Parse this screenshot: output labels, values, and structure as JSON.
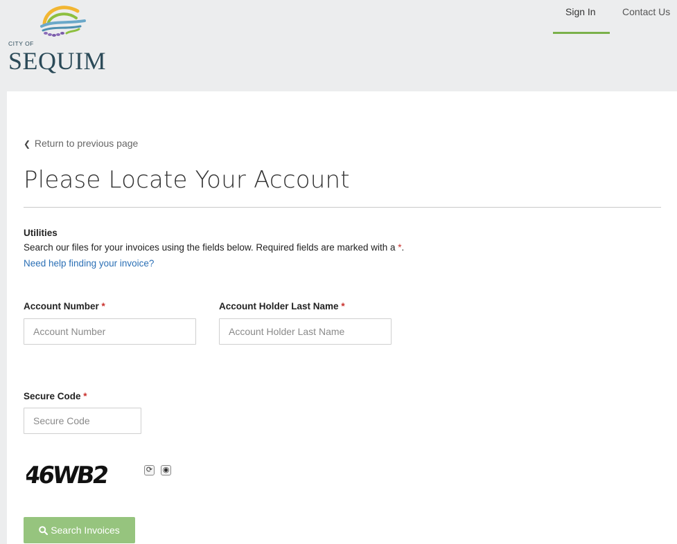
{
  "header": {
    "logo_small": "CITY OF",
    "logo_big": "SEQUIM",
    "nav": {
      "sign_in": "Sign In",
      "contact_us": "Contact Us"
    },
    "colors": {
      "background": "#ecedee",
      "active_underline": "#7ab04a"
    }
  },
  "main": {
    "back_link": "Return to previous page",
    "title": "Please Locate Your Account",
    "section_title": "Utilities",
    "intro_text": "Search our files for your invoices using the fields below.  Required fields are marked with a ",
    "intro_star": "*",
    "intro_end": ".",
    "help_link": "Need help finding your invoice?",
    "fields": {
      "account_number": {
        "label": "Account Number",
        "placeholder": "Account Number",
        "required_mark": "*"
      },
      "last_name": {
        "label": "Account Holder Last Name",
        "placeholder": "Account Holder Last Name",
        "required_mark": "*"
      },
      "secure_code": {
        "label": "Secure Code",
        "placeholder": "Secure Code",
        "required_mark": "*"
      }
    },
    "captcha": {
      "text": "46WB2",
      "refresh_icon": "refresh-icon",
      "audio_icon": "audio-icon"
    },
    "search_button": {
      "label": "Search Invoices",
      "icon": "search-icon",
      "color": "#96c47e"
    },
    "colors": {
      "required": "#c9302c",
      "link": "#2a6fb5"
    }
  }
}
